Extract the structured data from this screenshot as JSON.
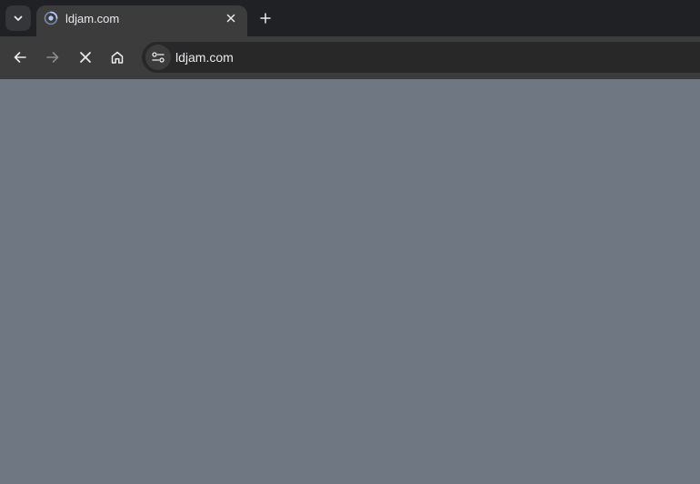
{
  "colors": {
    "tabstrip_bg": "#202124",
    "active_tab_bg": "#3c3c3c",
    "toolbar_bg": "#3c3c3c",
    "omnibox_bg": "#282828",
    "page_bg": "#6f7882",
    "text": "#e8eaed"
  },
  "tabs": [
    {
      "title": "ldjam.com",
      "favicon": "loading-spinner-icon",
      "active": true
    }
  ],
  "toolbar": {
    "icons": [
      "back-arrow-icon",
      "forward-arrow-icon",
      "stop-loading-icon",
      "home-icon"
    ]
  },
  "omnibox": {
    "site_info_icon": "tune-icon",
    "url": "ldjam.com"
  }
}
